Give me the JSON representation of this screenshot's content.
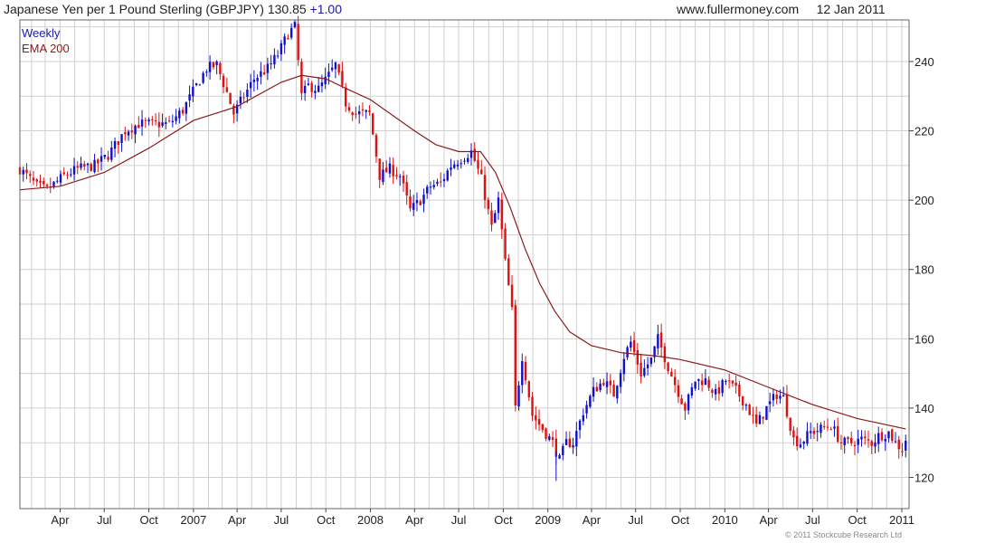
{
  "header": {
    "title": "Japanese Yen per 1 Pound Sterling (GBPJPY)",
    "last": "130.85",
    "change": "+1.00",
    "site": "www.fullermoney.com",
    "date": "12 Jan 2011"
  },
  "footer": {
    "copyright": "© 2011 Stockcube Research Ltd"
  },
  "colors": {
    "up": "#1010cc",
    "down": "#e01010",
    "ema": "#8b1a1a",
    "grid": "#d0d0d0",
    "legend_weekly": "#1a1aaa"
  },
  "chart_data": {
    "type": "candlestick",
    "legend": [
      "Weekly",
      "EMA 200"
    ],
    "xlim": [
      "2006-01-08",
      "2011-01-16"
    ],
    "ylim": [
      111,
      252
    ],
    "yticks": [
      120,
      140,
      160,
      180,
      200,
      220,
      240
    ],
    "grid": true,
    "y_axis_side": "right",
    "legend_position": "top-left",
    "xticks": [
      {
        "date": "2006-04-01",
        "label": "Apr"
      },
      {
        "date": "2006-07-01",
        "label": "Jul"
      },
      {
        "date": "2006-10-01",
        "label": "Oct"
      },
      {
        "date": "2007-01-01",
        "label": "2007"
      },
      {
        "date": "2007-04-01",
        "label": "Apr"
      },
      {
        "date": "2007-07-01",
        "label": "Jul"
      },
      {
        "date": "2007-10-01",
        "label": "Oct"
      },
      {
        "date": "2008-01-01",
        "label": "2008"
      },
      {
        "date": "2008-04-01",
        "label": "Apr"
      },
      {
        "date": "2008-07-01",
        "label": "Jul"
      },
      {
        "date": "2008-10-01",
        "label": "Oct"
      },
      {
        "date": "2009-01-01",
        "label": "2009"
      },
      {
        "date": "2009-04-01",
        "label": "Apr"
      },
      {
        "date": "2009-07-01",
        "label": "Jul"
      },
      {
        "date": "2009-10-01",
        "label": "Oct"
      },
      {
        "date": "2010-01-01",
        "label": "2010"
      },
      {
        "date": "2010-04-01",
        "label": "Apr"
      },
      {
        "date": "2010-07-01",
        "label": "Jul"
      },
      {
        "date": "2010-10-01",
        "label": "Oct"
      },
      {
        "date": "2011-01-01",
        "label": "2011"
      }
    ],
    "close_path": [
      [
        "2006-01-08",
        209
      ],
      [
        "2006-02-12",
        204
      ],
      [
        "2006-03-05",
        203
      ],
      [
        "2006-04-09",
        207
      ],
      [
        "2006-05-07",
        209
      ],
      [
        "2006-06-11",
        210
      ],
      [
        "2006-07-09",
        213
      ],
      [
        "2006-08-13",
        220
      ],
      [
        "2006-09-10",
        222
      ],
      [
        "2006-10-08",
        222
      ],
      [
        "2006-11-12",
        222
      ],
      [
        "2006-12-10",
        226
      ],
      [
        "2007-01-07",
        233
      ],
      [
        "2007-01-28",
        238
      ],
      [
        "2007-02-18",
        239
      ],
      [
        "2007-03-11",
        231
      ],
      [
        "2007-03-25",
        225
      ],
      [
        "2007-04-15",
        230
      ],
      [
        "2007-05-06",
        235
      ],
      [
        "2007-06-03",
        238
      ],
      [
        "2007-06-24",
        242
      ],
      [
        "2007-07-15",
        248
      ],
      [
        "2007-07-29",
        250
      ],
      [
        "2007-08-12",
        230
      ],
      [
        "2007-08-26",
        233
      ],
      [
        "2007-09-16",
        232
      ],
      [
        "2007-10-07",
        236
      ],
      [
        "2007-10-21",
        239
      ],
      [
        "2007-11-11",
        228
      ],
      [
        "2007-12-02",
        225
      ],
      [
        "2007-12-30",
        225
      ],
      [
        "2008-01-20",
        207
      ],
      [
        "2008-02-10",
        209
      ],
      [
        "2008-03-02",
        207
      ],
      [
        "2008-03-23",
        197
      ],
      [
        "2008-04-13",
        200
      ],
      [
        "2008-05-04",
        204
      ],
      [
        "2008-05-25",
        205
      ],
      [
        "2008-06-15",
        210
      ],
      [
        "2008-07-06",
        212
      ],
      [
        "2008-07-27",
        214
      ],
      [
        "2008-08-17",
        206
      ],
      [
        "2008-09-07",
        192
      ],
      [
        "2008-09-21",
        200
      ],
      [
        "2008-10-05",
        182
      ],
      [
        "2008-10-19",
        168
      ],
      [
        "2008-10-26",
        140
      ],
      [
        "2008-11-09",
        155
      ],
      [
        "2008-11-30",
        138
      ],
      [
        "2008-12-21",
        134
      ],
      [
        "2009-01-11",
        130
      ],
      [
        "2009-01-25",
        125
      ],
      [
        "2009-02-08",
        130
      ],
      [
        "2009-02-22",
        130
      ],
      [
        "2009-03-15",
        139
      ],
      [
        "2009-04-05",
        145
      ],
      [
        "2009-04-26",
        148
      ],
      [
        "2009-05-17",
        144
      ],
      [
        "2009-06-07",
        155
      ],
      [
        "2009-06-21",
        159
      ],
      [
        "2009-07-12",
        150
      ],
      [
        "2009-08-02",
        154
      ],
      [
        "2009-08-16",
        160
      ],
      [
        "2009-09-06",
        152
      ],
      [
        "2009-09-20",
        147
      ],
      [
        "2009-10-11",
        140
      ],
      [
        "2009-11-01",
        148
      ],
      [
        "2009-11-22",
        148
      ],
      [
        "2009-12-13",
        144
      ],
      [
        "2010-01-03",
        148
      ],
      [
        "2010-01-24",
        145
      ],
      [
        "2010-02-14",
        141
      ],
      [
        "2010-03-07",
        135
      ],
      [
        "2010-03-28",
        140
      ],
      [
        "2010-04-18",
        144
      ],
      [
        "2010-05-02",
        143
      ],
      [
        "2010-05-23",
        131
      ],
      [
        "2010-06-06",
        130
      ],
      [
        "2010-06-27",
        133
      ],
      [
        "2010-07-18",
        134
      ],
      [
        "2010-08-08",
        135
      ],
      [
        "2010-08-29",
        130
      ],
      [
        "2010-09-19",
        130
      ],
      [
        "2010-10-10",
        131
      ],
      [
        "2010-10-31",
        130
      ],
      [
        "2010-11-14",
        132
      ],
      [
        "2010-12-05",
        133
      ],
      [
        "2010-12-19",
        130
      ],
      [
        "2011-01-02",
        128
      ],
      [
        "2011-01-09",
        131
      ]
    ],
    "ema_200": [
      [
        "2006-01-08",
        203
      ],
      [
        "2006-04-01",
        204
      ],
      [
        "2006-07-01",
        208
      ],
      [
        "2006-10-01",
        215
      ],
      [
        "2007-01-01",
        223
      ],
      [
        "2007-04-01",
        227
      ],
      [
        "2007-07-01",
        234
      ],
      [
        "2007-08-12",
        236
      ],
      [
        "2007-10-01",
        235
      ],
      [
        "2007-11-15",
        232
      ],
      [
        "2008-01-01",
        229
      ],
      [
        "2008-04-01",
        220
      ],
      [
        "2008-05-15",
        216
      ],
      [
        "2008-07-01",
        214
      ],
      [
        "2008-08-15",
        214
      ],
      [
        "2008-09-15",
        208
      ],
      [
        "2008-10-15",
        198
      ],
      [
        "2008-11-15",
        186
      ],
      [
        "2008-12-15",
        176
      ],
      [
        "2009-01-15",
        168
      ],
      [
        "2009-02-15",
        162
      ],
      [
        "2009-04-01",
        158
      ],
      [
        "2009-06-01",
        156
      ],
      [
        "2009-08-15",
        155
      ],
      [
        "2009-10-01",
        154
      ],
      [
        "2010-01-01",
        151
      ],
      [
        "2010-04-01",
        146
      ],
      [
        "2010-07-01",
        141
      ],
      [
        "2010-10-01",
        137
      ],
      [
        "2011-01-09",
        134
      ]
    ],
    "notable_extremes": {
      "high": {
        "date": "2007-07-22",
        "value": 251
      },
      "low": {
        "date": "2009-01-18",
        "value": 119
      }
    }
  }
}
